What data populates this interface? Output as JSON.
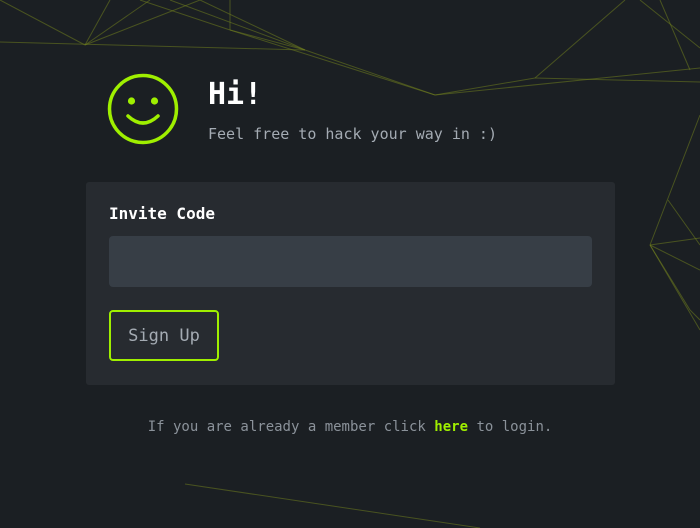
{
  "header": {
    "greeting": "Hi!",
    "tagline": "Feel free to hack your way in :)",
    "icon": "smiley-icon"
  },
  "form": {
    "invite_label": "Invite Code",
    "invite_value": "",
    "signup_label": "Sign Up"
  },
  "footer": {
    "prefix": "If you are already a member click",
    "link_text": "here",
    "suffix": "to login."
  },
  "colors": {
    "accent": "#9fef00",
    "background": "#1b1f23",
    "card": "#272b30",
    "input": "#373e46",
    "muted_text": "#a4abb3"
  }
}
